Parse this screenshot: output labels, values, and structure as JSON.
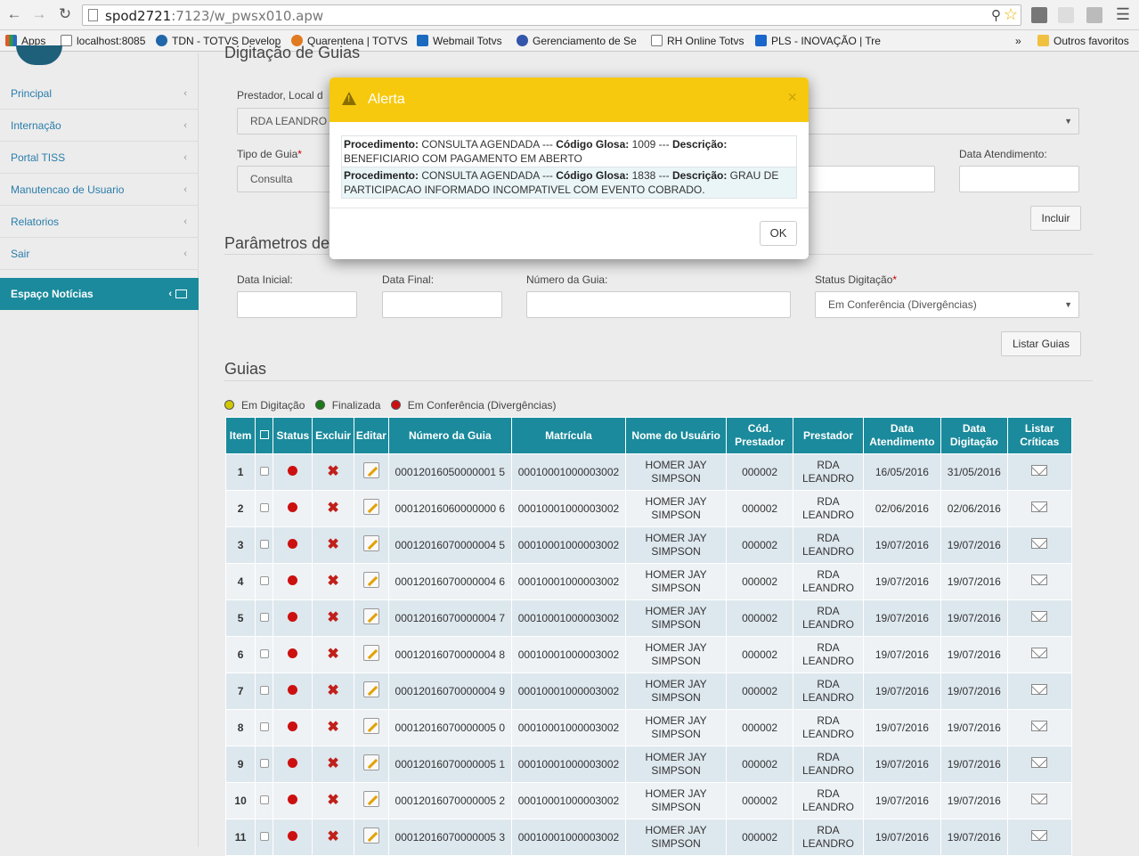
{
  "browser": {
    "url_host": "spod2721",
    "url_path": ":7123/w_pwsx010.apw",
    "bookmarks": [
      {
        "label": "Apps",
        "color": "#e05a2a"
      },
      {
        "label": "localhost:8085",
        "color": "#ffffff"
      },
      {
        "label": "TDN - TOTVS Develop",
        "color": "#2266aa"
      },
      {
        "label": "Quarentena | TOTVS",
        "color": "#e07a20"
      },
      {
        "label": "Webmail Totvs",
        "color": "#1a6bbf"
      },
      {
        "label": "Gerenciamento de Se",
        "color": "#3355aa"
      },
      {
        "label": "RH Online Totvs",
        "color": "#ffffff"
      },
      {
        "label": "PLS - INOVAÇÃO | Tre",
        "color": "#1a66cc"
      }
    ],
    "more": "»",
    "other_bookmarks": "Outros favoritos"
  },
  "sidebar": {
    "items": [
      {
        "label": "Principal"
      },
      {
        "label": "Internação"
      },
      {
        "label": "Portal TISS"
      },
      {
        "label": "Manutencao de Usuario"
      },
      {
        "label": "Relatorios"
      },
      {
        "label": "Sair"
      }
    ],
    "news": "Espaço Notícias"
  },
  "page": {
    "title": "Digitação de Guias",
    "prestador_label": "Prestador, Local d",
    "prestador_value": "RDA LEANDRO",
    "tipo_label": "Tipo de Guia",
    "tipo_value": "Consulta",
    "data_atendimento_label": "Data Atendimento:",
    "incluir": "Incluir",
    "params_title": "Parâmetros de",
    "data_inicial": "Data Inicial:",
    "data_final": "Data Final:",
    "numero_guia": "Número da Guia:",
    "status_label": "Status Digitação",
    "status_value": "Em Conferência (Divergências)",
    "listar": "Listar Guias",
    "guias_title": "Guias",
    "legend": [
      "Em Digitação",
      "Finalizada",
      "Em Conferência (Divergências)"
    ],
    "legend_colors": [
      "#d2c800",
      "#1a7a1a",
      "#cc1010"
    ]
  },
  "table": {
    "headers": [
      "Item",
      "",
      "Status",
      "Excluir",
      "Editar",
      "Número da Guia",
      "Matrícula",
      "Nome do Usuário",
      "Cód. Prestador",
      "Prestador",
      "Data Atendimento",
      "Data Digitação",
      "Listar Críticas"
    ],
    "rows": [
      {
        "item": "1",
        "guia": "00012016050000001 5",
        "matricula": "00010001000003002",
        "nome": "HOMER JAY SIMPSON",
        "cod": "000002",
        "prestador": "RDA LEANDRO",
        "atend": "16/05/2016",
        "digit": "31/05/2016"
      },
      {
        "item": "2",
        "guia": "00012016060000000 6",
        "matricula": "00010001000003002",
        "nome": "HOMER JAY SIMPSON",
        "cod": "000002",
        "prestador": "RDA LEANDRO",
        "atend": "02/06/2016",
        "digit": "02/06/2016"
      },
      {
        "item": "3",
        "guia": "00012016070000004 5",
        "matricula": "00010001000003002",
        "nome": "HOMER JAY SIMPSON",
        "cod": "000002",
        "prestador": "RDA LEANDRO",
        "atend": "19/07/2016",
        "digit": "19/07/2016"
      },
      {
        "item": "4",
        "guia": "00012016070000004 6",
        "matricula": "00010001000003002",
        "nome": "HOMER JAY SIMPSON",
        "cod": "000002",
        "prestador": "RDA LEANDRO",
        "atend": "19/07/2016",
        "digit": "19/07/2016"
      },
      {
        "item": "5",
        "guia": "00012016070000004 7",
        "matricula": "00010001000003002",
        "nome": "HOMER JAY SIMPSON",
        "cod": "000002",
        "prestador": "RDA LEANDRO",
        "atend": "19/07/2016",
        "digit": "19/07/2016"
      },
      {
        "item": "6",
        "guia": "00012016070000004 8",
        "matricula": "00010001000003002",
        "nome": "HOMER JAY SIMPSON",
        "cod": "000002",
        "prestador": "RDA LEANDRO",
        "atend": "19/07/2016",
        "digit": "19/07/2016"
      },
      {
        "item": "7",
        "guia": "00012016070000004 9",
        "matricula": "00010001000003002",
        "nome": "HOMER JAY SIMPSON",
        "cod": "000002",
        "prestador": "RDA LEANDRO",
        "atend": "19/07/2016",
        "digit": "19/07/2016"
      },
      {
        "item": "8",
        "guia": "00012016070000005 0",
        "matricula": "00010001000003002",
        "nome": "HOMER JAY SIMPSON",
        "cod": "000002",
        "prestador": "RDA LEANDRO",
        "atend": "19/07/2016",
        "digit": "19/07/2016"
      },
      {
        "item": "9",
        "guia": "00012016070000005 1",
        "matricula": "00010001000003002",
        "nome": "HOMER JAY SIMPSON",
        "cod": "000002",
        "prestador": "RDA LEANDRO",
        "atend": "19/07/2016",
        "digit": "19/07/2016"
      },
      {
        "item": "10",
        "guia": "00012016070000005 2",
        "matricula": "00010001000003002",
        "nome": "HOMER JAY SIMPSON",
        "cod": "000002",
        "prestador": "RDA LEANDRO",
        "atend": "19/07/2016",
        "digit": "19/07/2016"
      },
      {
        "item": "11",
        "guia": "00012016070000005 3",
        "matricula": "00010001000003002",
        "nome": "HOMER JAY SIMPSON",
        "cod": "000002",
        "prestador": "RDA LEANDRO",
        "atend": "19/07/2016",
        "digit": "19/07/2016"
      }
    ]
  },
  "modal": {
    "title": "Alerta",
    "close": "×",
    "messages": [
      {
        "proc_label": "Procedimento:",
        "proc": " CONSULTA AGENDADA --- ",
        "glosa_label": "Código Glosa:",
        "glosa": " 1009 --- ",
        "desc_label": "Descrição:",
        "desc": " BENEFICIARIO COM PAGAMENTO EM ABERTO"
      },
      {
        "proc_label": "Procedimento:",
        "proc": " CONSULTA AGENDADA --- ",
        "glosa_label": "Código Glosa:",
        "glosa": " 1838 --- ",
        "desc_label": "Descrição:",
        "desc": " GRAU DE PARTICIPACAO INFORMADO INCOMPATIVEL COM EVENTO COBRADO."
      }
    ],
    "ok": "OK"
  }
}
